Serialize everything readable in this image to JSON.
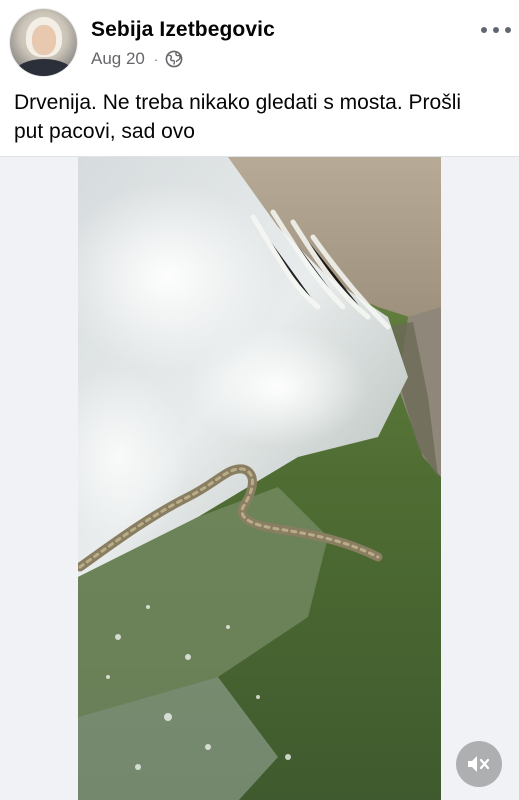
{
  "post": {
    "author": "Sebija Izetbegovic",
    "date": "Aug 20",
    "separator": "·",
    "audience_icon": "globe-icon",
    "more_icon": "more-horizontal-icon",
    "caption": "Drvenija. Ne treba nikako gledati s mosta. Prošli\nput pacovi, sad ovo"
  },
  "video": {
    "subject": "snake-in-water-video",
    "mute_icon": "speaker-muted-icon"
  },
  "colors": {
    "name_text": "#050505",
    "meta_text": "#65676b",
    "media_background": "#f0f2f5"
  }
}
